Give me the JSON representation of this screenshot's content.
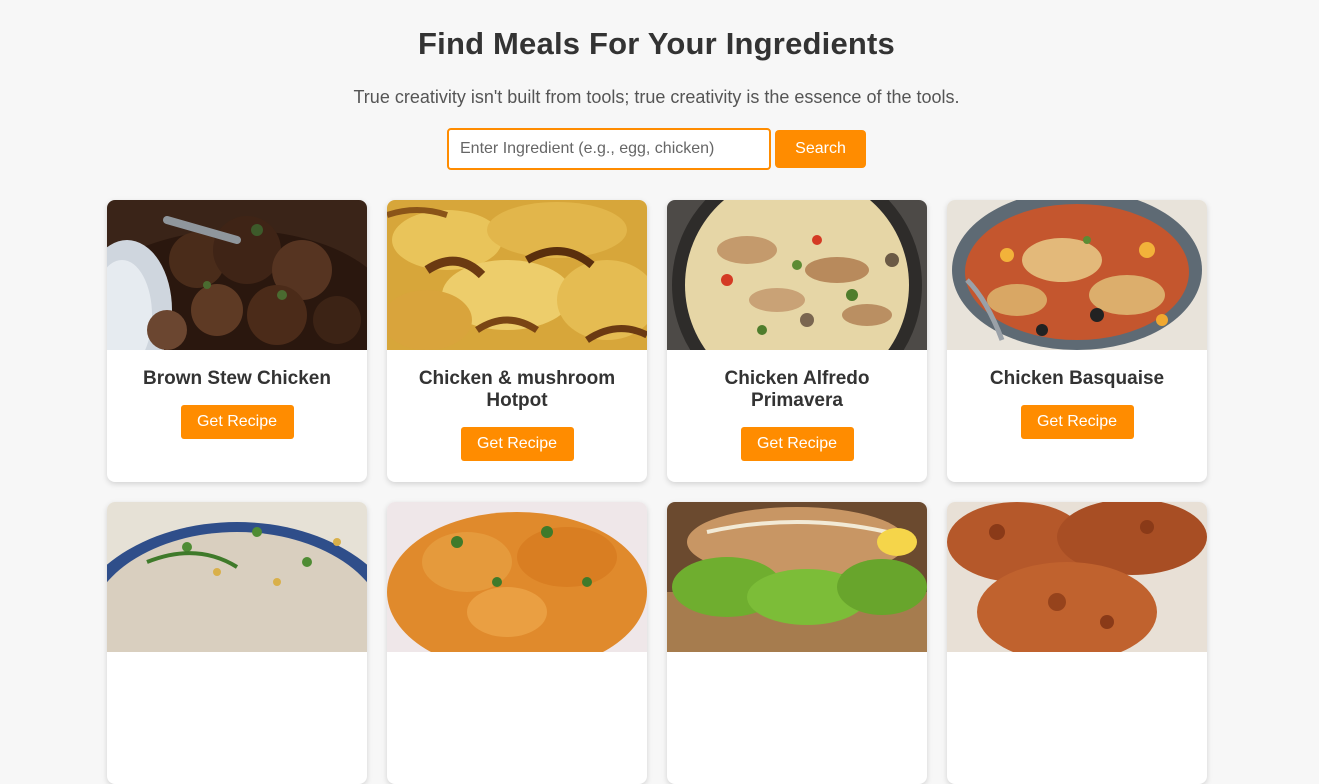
{
  "header": {
    "title": "Find Meals For Your Ingredients",
    "tagline": "True creativity isn't built from tools; true creativity is the essence of the tools."
  },
  "search": {
    "placeholder": "Enter Ingredient (e.g., egg, chicken)",
    "value": "",
    "button_label": "Search"
  },
  "meals": [
    {
      "title": "Brown Stew Chicken",
      "button_label": "Get Recipe"
    },
    {
      "title": "Chicken & mushroom Hotpot",
      "button_label": "Get Recipe"
    },
    {
      "title": "Chicken Alfredo Primavera",
      "button_label": "Get Recipe"
    },
    {
      "title": "Chicken Basquaise",
      "button_label": "Get Recipe"
    },
    {
      "title": "",
      "button_label": ""
    },
    {
      "title": "",
      "button_label": ""
    },
    {
      "title": "",
      "button_label": ""
    },
    {
      "title": "",
      "button_label": ""
    }
  ],
  "colors": {
    "accent": "#ff8c00",
    "background": "#f7f7f7",
    "text": "#333333"
  }
}
